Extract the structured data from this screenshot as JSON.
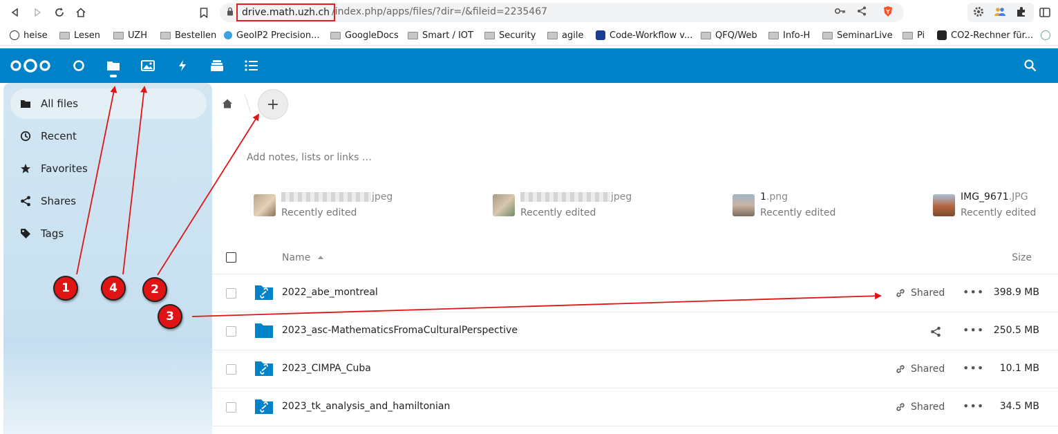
{
  "browser": {
    "url_host": "drive.math.uzh.ch",
    "url_path": "/index.php/apps/files/?dir=/&fileid=2235467",
    "bookmarks": [
      {
        "label": "heise",
        "icon": "heise-icon"
      },
      {
        "label": "Lesen",
        "icon": "folder-icon"
      },
      {
        "label": "UZH",
        "icon": "folder-icon"
      },
      {
        "label": "Bestellen",
        "icon": "folder-icon"
      },
      {
        "label": "GeoIP2 Precision...",
        "icon": "geoip-icon"
      },
      {
        "label": "GoogleDocs",
        "icon": "folder-icon"
      },
      {
        "label": "Smart / IOT",
        "icon": "folder-icon"
      },
      {
        "label": "Security",
        "icon": "folder-icon"
      },
      {
        "label": "agile",
        "icon": "folder-icon"
      },
      {
        "label": "Code-Workflow v...",
        "icon": "graduation-cap-icon"
      },
      {
        "label": "QFQ/Web",
        "icon": "folder-icon"
      },
      {
        "label": "Info-H",
        "icon": "folder-icon"
      },
      {
        "label": "SeminarLive",
        "icon": "folder-icon"
      },
      {
        "label": "Pi",
        "icon": "folder-icon"
      },
      {
        "label": "CO2-Rechner für...",
        "icon": "co2-icon"
      }
    ]
  },
  "sidebar": {
    "items": [
      {
        "label": "All files",
        "icon": "folder-icon",
        "active": true
      },
      {
        "label": "Recent",
        "icon": "clock-icon"
      },
      {
        "label": "Favorites",
        "icon": "star-icon"
      },
      {
        "label": "Shares",
        "icon": "share-icon"
      },
      {
        "label": "Tags",
        "icon": "tag-icon"
      }
    ]
  },
  "main": {
    "notes_placeholder": "Add notes, lists or links …",
    "add_label": "+",
    "recent": [
      {
        "name_ext": "jpeg",
        "status": "Recently edited"
      },
      {
        "name_ext": "jpeg",
        "status": "Recently edited"
      },
      {
        "name_base": "1",
        "name_ext": ".png",
        "status": "Recently edited"
      },
      {
        "name_base": "IMG_9671",
        "name_ext": ".JPG",
        "status": "Recently edited"
      }
    ],
    "columns": {
      "name": "Name",
      "size": "Size"
    },
    "files": [
      {
        "name": "2022_abe_montreal",
        "shared": true,
        "share_label": "Shared",
        "size": "398.9 MB"
      },
      {
        "name": "2023_asc-MathematicsFromaCulturalPerspective",
        "shared": false,
        "share_label": "",
        "size": "250.5 MB"
      },
      {
        "name": "2023_CIMPA_Cuba",
        "shared": true,
        "share_label": "Shared",
        "size": "10.1 MB"
      },
      {
        "name": "2023_tk_analysis_and_hamiltonian",
        "shared": true,
        "share_label": "Shared",
        "size": "34.5 MB"
      }
    ]
  },
  "annotations": [
    {
      "label": "1"
    },
    {
      "label": "4"
    },
    {
      "label": "2"
    },
    {
      "label": "3"
    }
  ],
  "colors": {
    "header": "#0082c9",
    "marker": "#e01414",
    "arrow": "#e01414"
  }
}
